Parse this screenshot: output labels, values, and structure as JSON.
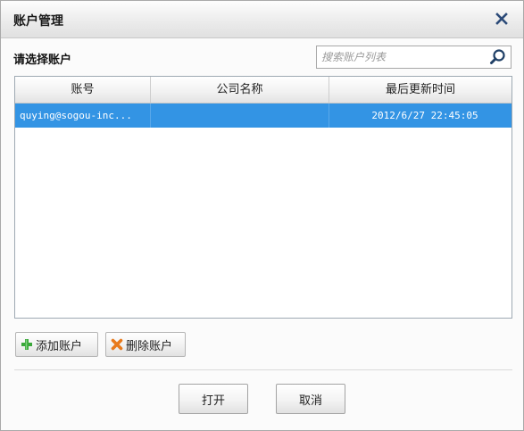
{
  "dialog": {
    "title": "账户管理",
    "close_icon": "close-icon"
  },
  "section_label": "请选择账户",
  "search": {
    "placeholder": "搜索账户列表",
    "value": "",
    "icon": "search-icon"
  },
  "table": {
    "columns": [
      "账号",
      "公司名称",
      "最后更新时间"
    ],
    "rows": [
      {
        "account": "quying@sogou-inc...",
        "company": "",
        "updated": "2012/6/27 22:45:05",
        "selected": true
      }
    ]
  },
  "actions": {
    "add_label": "添加账户",
    "add_icon": "plus-icon",
    "delete_label": "删除账户",
    "delete_icon": "delete-x-icon"
  },
  "footer": {
    "open_label": "打开",
    "cancel_label": "取消"
  },
  "colors": {
    "selection": "#3394e4",
    "add_icon": "#3aa83a",
    "delete_icon": "#e87a1c",
    "close_icon": "#2b4a78"
  }
}
